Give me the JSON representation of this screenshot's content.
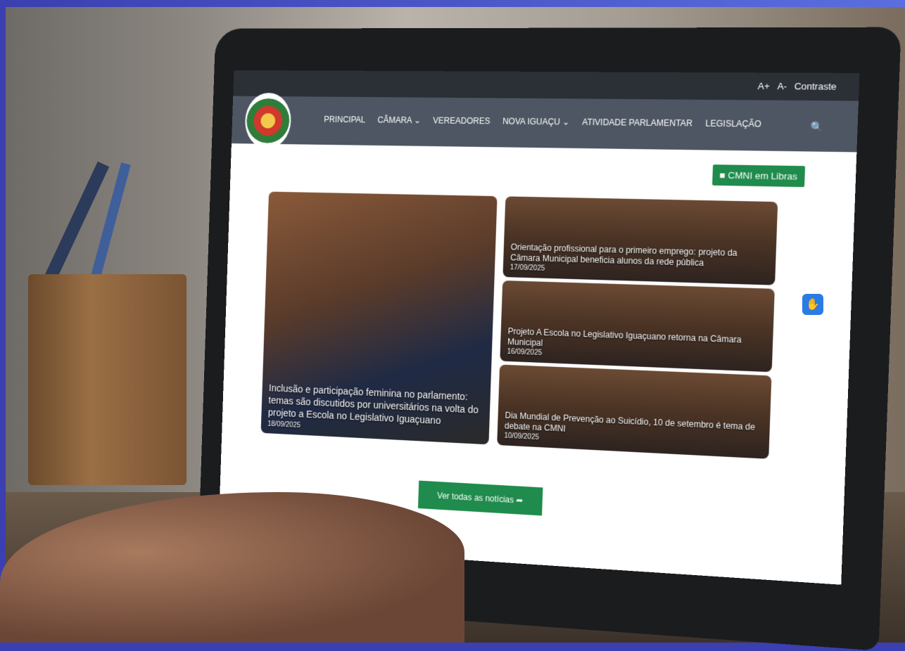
{
  "topbar": {
    "font_increase": "A+",
    "font_decrease": "A-",
    "contrast": "Contraste"
  },
  "nav": {
    "items": [
      {
        "label": "PRINCIPAL"
      },
      {
        "label": "CÂMARA ⌄"
      },
      {
        "label": "VEREADORES"
      },
      {
        "label": "NOVA IGUAÇU ⌄"
      },
      {
        "label": "ATIVIDADE PARLAMENTAR"
      },
      {
        "label": "LEGISLAÇÃO"
      }
    ],
    "search_icon": "search-icon"
  },
  "libras_button": "CMNI em Libras",
  "news": {
    "main": {
      "title": "Inclusão e participação feminina no parlamento: temas são discutidos por universitários na volta do projeto a Escola no Legislativo Iguaçuano",
      "date": "18/09/2025"
    },
    "side": [
      {
        "title": "Orientação profissional para o primeiro emprego: projeto da Câmara Municipal beneficia alunos da rede pública",
        "date": "17/09/2025"
      },
      {
        "title": "Projeto A Escola no Legislativo Iguaçuano retorna na Câmara Municipal",
        "date": "16/09/2025"
      },
      {
        "title": "Dia Mundial de Prevenção ao Suicídio, 10 de setembro é tema de debate na CMNI",
        "date": "10/09/2025"
      }
    ]
  },
  "see_all_button": "Ver todas as notícias ➦",
  "accessibility_icon": "hand-sign-icon"
}
